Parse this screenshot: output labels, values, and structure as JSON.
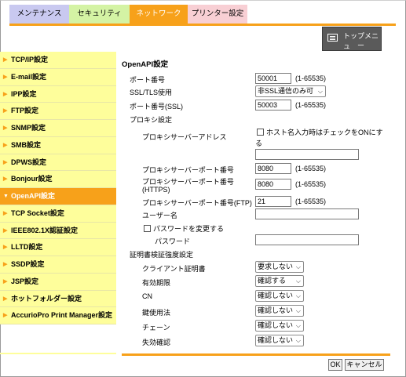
{
  "tabs": [
    "メンテナンス",
    "セキュリティ",
    "ネットワーク",
    "プリンター設定"
  ],
  "top_menu_button": {
    "line1": "トップメニュ",
    "line2": "ー",
    "icon": "menu-list-icon"
  },
  "sidebar": {
    "items": [
      {
        "label": "TCP/IP設定"
      },
      {
        "label": "E-mail設定"
      },
      {
        "label": "IPP設定"
      },
      {
        "label": "FTP設定"
      },
      {
        "label": "SNMP設定"
      },
      {
        "label": "SMB設定"
      },
      {
        "label": "DPWS設定"
      },
      {
        "label": "Bonjour設定"
      },
      {
        "label": "OpenAPI設定"
      },
      {
        "label": "TCP Socket設定"
      },
      {
        "label": "IEEE802.1X認証設定"
      },
      {
        "label": "LLTD設定"
      },
      {
        "label": "SSDP設定"
      },
      {
        "label": "JSP設定"
      },
      {
        "label": "ホットフォルダー設定"
      },
      {
        "label": "AccurioPro Print Manager設定"
      }
    ],
    "active_index": 8,
    "arrow": "▶",
    "active_arrow": "▼"
  },
  "form": {
    "title": "OpenAPI設定",
    "port_label": "ポート番号",
    "port_value": "50001",
    "port_range": "(1-65535)",
    "ssl_label": "SSL/TLS使用",
    "ssl_value": "非SSL通信のみ可",
    "ssl_port_label": "ポート番号(SSL)",
    "ssl_port_value": "50003",
    "ssl_port_range": "(1-65535)",
    "proxy_section": "プロキシ設定",
    "proxy_address_label": "プロキシサーバーアドレス",
    "hostname_check_label": "ホスト名入力時はチェックをONにす",
    "hostname_check_label2": "る",
    "proxy_address_value": "",
    "proxy_port_label": "プロキシサーバーポート番号",
    "proxy_port_value": "8080",
    "proxy_port_range": "(1-65535)",
    "proxy_https_label": "プロキシサーバーポート番号",
    "proxy_https_label2": "(HTTPS)",
    "proxy_https_value": "8080",
    "proxy_https_range": "(1-65535)",
    "proxy_ftp_label": "プロキシサーバーポート番号(FTP)",
    "proxy_ftp_value": "21",
    "proxy_ftp_range": "(1-65535)",
    "username_label": "ユーザー名",
    "username_value": "",
    "change_password_label": "パスワードを変更する",
    "password_label": "パスワード",
    "password_value": "",
    "cert_section": "証明書検証強度設定",
    "client_cert_label": "クライアント証明書",
    "client_cert_value": "要求しない",
    "validity_label": "有効期限",
    "validity_value": "確認する",
    "cn_label": "CN",
    "cn_value": "確認しない",
    "key_usage_label": "鍵使用法",
    "key_usage_value": "確認しない",
    "chain_label": "チェーン",
    "chain_value": "確認しない",
    "revocation_label": "失効確認",
    "revocation_value": "確認しない"
  },
  "buttons": {
    "ok": "OK",
    "cancel": "キャンセル"
  }
}
